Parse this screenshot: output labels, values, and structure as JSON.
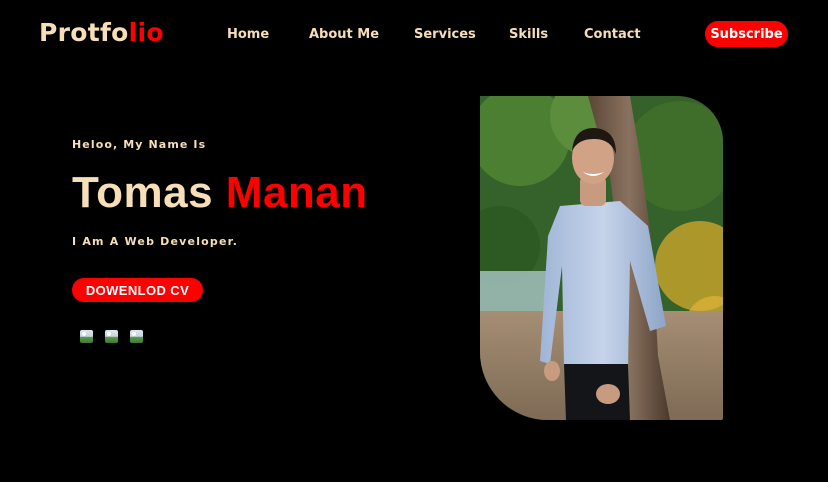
{
  "nav": {
    "logo_part1": "Protfo",
    "logo_part2": "lio",
    "links": [
      "Home",
      "About Me",
      "Services",
      "Skills",
      "Contact"
    ],
    "subscribe": "Subscribe"
  },
  "hero": {
    "greeting": "Heloo, My Name Is",
    "first_name": "Tomas",
    "last_name": "Manan",
    "role": "I Am A Web Developer.",
    "cv_button": "DOWENLOD CV"
  },
  "social": {
    "icons": [
      "broken-image-icon",
      "broken-image-icon",
      "broken-image-icon"
    ]
  },
  "colors": {
    "background": "#000000",
    "accent": "#ff0000",
    "text": "#f6dfb8"
  }
}
